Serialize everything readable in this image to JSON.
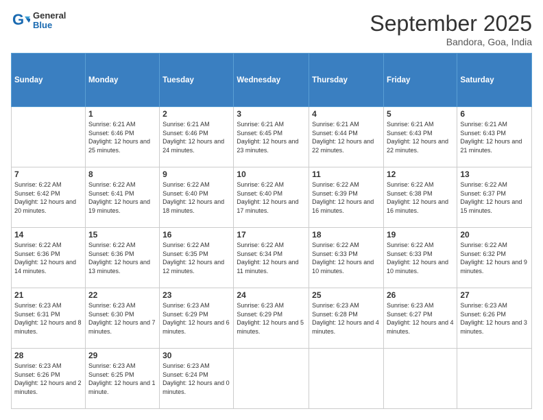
{
  "header": {
    "logo_general": "General",
    "logo_blue": "Blue",
    "month_title": "September 2025",
    "location": "Bandora, Goa, India"
  },
  "days_of_week": [
    "Sunday",
    "Monday",
    "Tuesday",
    "Wednesday",
    "Thursday",
    "Friday",
    "Saturday"
  ],
  "weeks": [
    [
      {
        "day": "",
        "info": ""
      },
      {
        "day": "1",
        "info": "Sunrise: 6:21 AM\nSunset: 6:46 PM\nDaylight: 12 hours\nand 25 minutes."
      },
      {
        "day": "2",
        "info": "Sunrise: 6:21 AM\nSunset: 6:46 PM\nDaylight: 12 hours\nand 24 minutes."
      },
      {
        "day": "3",
        "info": "Sunrise: 6:21 AM\nSunset: 6:45 PM\nDaylight: 12 hours\nand 23 minutes."
      },
      {
        "day": "4",
        "info": "Sunrise: 6:21 AM\nSunset: 6:44 PM\nDaylight: 12 hours\nand 22 minutes."
      },
      {
        "day": "5",
        "info": "Sunrise: 6:21 AM\nSunset: 6:43 PM\nDaylight: 12 hours\nand 22 minutes."
      },
      {
        "day": "6",
        "info": "Sunrise: 6:21 AM\nSunset: 6:43 PM\nDaylight: 12 hours\nand 21 minutes."
      }
    ],
    [
      {
        "day": "7",
        "info": "Sunrise: 6:22 AM\nSunset: 6:42 PM\nDaylight: 12 hours\nand 20 minutes."
      },
      {
        "day": "8",
        "info": "Sunrise: 6:22 AM\nSunset: 6:41 PM\nDaylight: 12 hours\nand 19 minutes."
      },
      {
        "day": "9",
        "info": "Sunrise: 6:22 AM\nSunset: 6:40 PM\nDaylight: 12 hours\nand 18 minutes."
      },
      {
        "day": "10",
        "info": "Sunrise: 6:22 AM\nSunset: 6:40 PM\nDaylight: 12 hours\nand 17 minutes."
      },
      {
        "day": "11",
        "info": "Sunrise: 6:22 AM\nSunset: 6:39 PM\nDaylight: 12 hours\nand 16 minutes."
      },
      {
        "day": "12",
        "info": "Sunrise: 6:22 AM\nSunset: 6:38 PM\nDaylight: 12 hours\nand 16 minutes."
      },
      {
        "day": "13",
        "info": "Sunrise: 6:22 AM\nSunset: 6:37 PM\nDaylight: 12 hours\nand 15 minutes."
      }
    ],
    [
      {
        "day": "14",
        "info": "Sunrise: 6:22 AM\nSunset: 6:36 PM\nDaylight: 12 hours\nand 14 minutes."
      },
      {
        "day": "15",
        "info": "Sunrise: 6:22 AM\nSunset: 6:36 PM\nDaylight: 12 hours\nand 13 minutes."
      },
      {
        "day": "16",
        "info": "Sunrise: 6:22 AM\nSunset: 6:35 PM\nDaylight: 12 hours\nand 12 minutes."
      },
      {
        "day": "17",
        "info": "Sunrise: 6:22 AM\nSunset: 6:34 PM\nDaylight: 12 hours\nand 11 minutes."
      },
      {
        "day": "18",
        "info": "Sunrise: 6:22 AM\nSunset: 6:33 PM\nDaylight: 12 hours\nand 10 minutes."
      },
      {
        "day": "19",
        "info": "Sunrise: 6:22 AM\nSunset: 6:33 PM\nDaylight: 12 hours\nand 10 minutes."
      },
      {
        "day": "20",
        "info": "Sunrise: 6:22 AM\nSunset: 6:32 PM\nDaylight: 12 hours\nand 9 minutes."
      }
    ],
    [
      {
        "day": "21",
        "info": "Sunrise: 6:23 AM\nSunset: 6:31 PM\nDaylight: 12 hours\nand 8 minutes."
      },
      {
        "day": "22",
        "info": "Sunrise: 6:23 AM\nSunset: 6:30 PM\nDaylight: 12 hours\nand 7 minutes."
      },
      {
        "day": "23",
        "info": "Sunrise: 6:23 AM\nSunset: 6:29 PM\nDaylight: 12 hours\nand 6 minutes."
      },
      {
        "day": "24",
        "info": "Sunrise: 6:23 AM\nSunset: 6:29 PM\nDaylight: 12 hours\nand 5 minutes."
      },
      {
        "day": "25",
        "info": "Sunrise: 6:23 AM\nSunset: 6:28 PM\nDaylight: 12 hours\nand 4 minutes."
      },
      {
        "day": "26",
        "info": "Sunrise: 6:23 AM\nSunset: 6:27 PM\nDaylight: 12 hours\nand 4 minutes."
      },
      {
        "day": "27",
        "info": "Sunrise: 6:23 AM\nSunset: 6:26 PM\nDaylight: 12 hours\nand 3 minutes."
      }
    ],
    [
      {
        "day": "28",
        "info": "Sunrise: 6:23 AM\nSunset: 6:26 PM\nDaylight: 12 hours\nand 2 minutes."
      },
      {
        "day": "29",
        "info": "Sunrise: 6:23 AM\nSunset: 6:25 PM\nDaylight: 12 hours\nand 1 minute."
      },
      {
        "day": "30",
        "info": "Sunrise: 6:23 AM\nSunset: 6:24 PM\nDaylight: 12 hours\nand 0 minutes."
      },
      {
        "day": "",
        "info": ""
      },
      {
        "day": "",
        "info": ""
      },
      {
        "day": "",
        "info": ""
      },
      {
        "day": "",
        "info": ""
      }
    ]
  ]
}
